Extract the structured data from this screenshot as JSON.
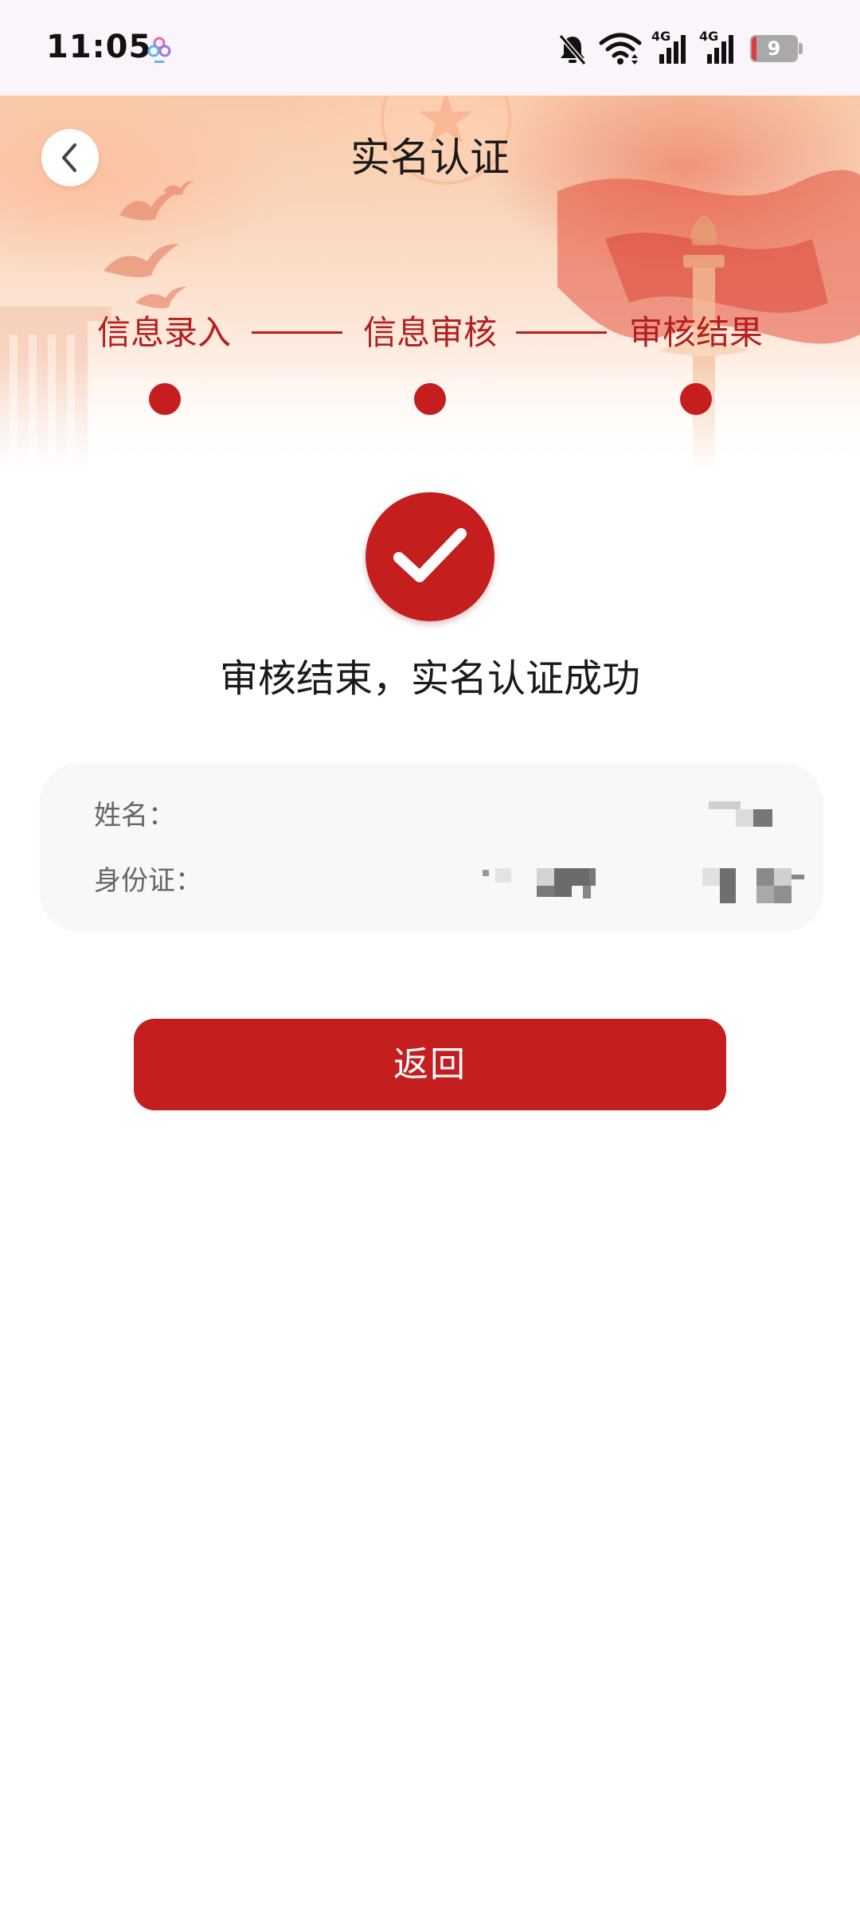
{
  "status_bar": {
    "time": "11:05",
    "battery_level": "9",
    "network_left": "4G",
    "network_right": "4G",
    "icons": [
      "app-icon",
      "silent-bell-icon",
      "wifi-icon",
      "signal-icon",
      "signal-icon",
      "battery-icon"
    ]
  },
  "header": {
    "title": "实名认证",
    "back_icon": "chevron-left-icon"
  },
  "steps": [
    {
      "label": "信息录入"
    },
    {
      "label": "信息审核"
    },
    {
      "label": "审核结果"
    }
  ],
  "result": {
    "icon": "check-circle-icon",
    "message": "审核结束，实名认证成功"
  },
  "info": {
    "name_label": "姓名：",
    "id_label": "身份证："
  },
  "actions": {
    "return_label": "返回"
  },
  "colors": {
    "accent": "#c41e1f",
    "step_text": "#b32020",
    "status_bar_bg": "#fcf4fb",
    "card_bg": "#f8f8f8"
  }
}
